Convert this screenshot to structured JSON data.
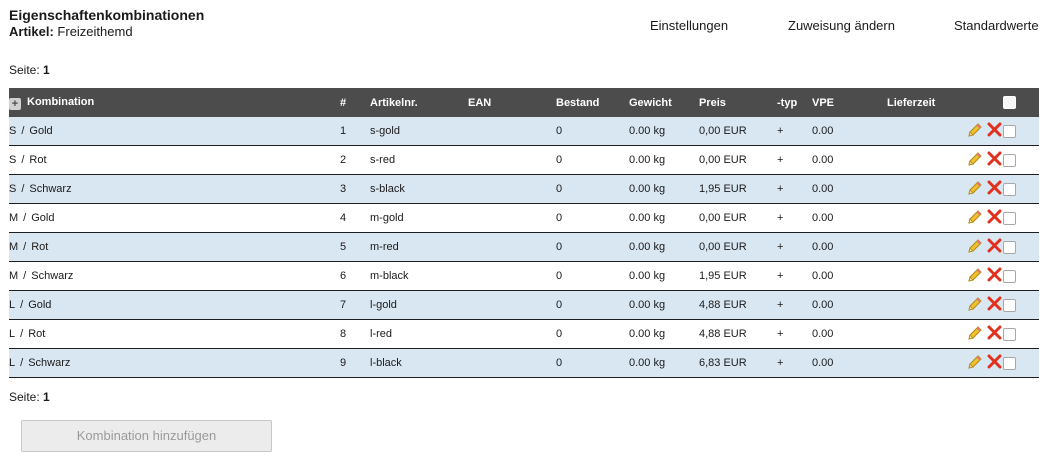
{
  "header": {
    "title": "Eigenschaftenkombinationen",
    "article_label": "Artikel:",
    "article_value": "Freizeithemd"
  },
  "topnav": {
    "settings": "Einstellungen",
    "change_assignment": "Zuweisung ändern",
    "defaults": "Standardwerte"
  },
  "pagination": {
    "label": "Seite:",
    "page": "1"
  },
  "table": {
    "columns": {
      "combination": "Kombination",
      "number": "#",
      "article_no": "Artikelnr.",
      "ean": "EAN",
      "stock": "Bestand",
      "weight": "Gewicht",
      "price": "Preis",
      "type": "-typ",
      "vpe": "VPE",
      "delivery": "Lieferzeit"
    },
    "rows": [
      {
        "size": "S",
        "color": "Gold",
        "num": "1",
        "art": "s-gold",
        "ean": "",
        "stock": "0",
        "weight": "0.00 kg",
        "price": "0,00 EUR",
        "typ": "+",
        "vpe": "0.00",
        "lief": ""
      },
      {
        "size": "S",
        "color": "Rot",
        "num": "2",
        "art": "s-red",
        "ean": "",
        "stock": "0",
        "weight": "0.00 kg",
        "price": "0,00 EUR",
        "typ": "+",
        "vpe": "0.00",
        "lief": ""
      },
      {
        "size": "S",
        "color": "Schwarz",
        "num": "3",
        "art": "s-black",
        "ean": "",
        "stock": "0",
        "weight": "0.00 kg",
        "price": "1,95 EUR",
        "typ": "+",
        "vpe": "0.00",
        "lief": ""
      },
      {
        "size": "M",
        "color": "Gold",
        "num": "4",
        "art": "m-gold",
        "ean": "",
        "stock": "0",
        "weight": "0.00 kg",
        "price": "0,00 EUR",
        "typ": "+",
        "vpe": "0.00",
        "lief": ""
      },
      {
        "size": "M",
        "color": "Rot",
        "num": "5",
        "art": "m-red",
        "ean": "",
        "stock": "0",
        "weight": "0.00 kg",
        "price": "0,00 EUR",
        "typ": "+",
        "vpe": "0.00",
        "lief": ""
      },
      {
        "size": "M",
        "color": "Schwarz",
        "num": "6",
        "art": "m-black",
        "ean": "",
        "stock": "0",
        "weight": "0.00 kg",
        "price": "1,95 EUR",
        "typ": "+",
        "vpe": "0.00",
        "lief": ""
      },
      {
        "size": "L",
        "color": "Gold",
        "num": "7",
        "art": "l-gold",
        "ean": "",
        "stock": "0",
        "weight": "0.00 kg",
        "price": "4,88 EUR",
        "typ": "+",
        "vpe": "0.00",
        "lief": ""
      },
      {
        "size": "L",
        "color": "Rot",
        "num": "8",
        "art": "l-red",
        "ean": "",
        "stock": "0",
        "weight": "0.00 kg",
        "price": "4,88 EUR",
        "typ": "+",
        "vpe": "0.00",
        "lief": ""
      },
      {
        "size": "L",
        "color": "Schwarz",
        "num": "9",
        "art": "l-black",
        "ean": "",
        "stock": "0",
        "weight": "0.00 kg",
        "price": "6,83 EUR",
        "typ": "+",
        "vpe": "0.00",
        "lief": ""
      }
    ],
    "separator": "/"
  },
  "icons": {
    "expand": "plus-square-icon",
    "edit": "pencil-icon",
    "delete": "red-x-icon"
  },
  "colors": {
    "header_bg": "#4c4c4c",
    "row_alt_bg": "#d9e7f3",
    "delete_red": "#e0301e",
    "edit_yellow": "#f0c030"
  },
  "add_button": "Kombination hinzufügen"
}
